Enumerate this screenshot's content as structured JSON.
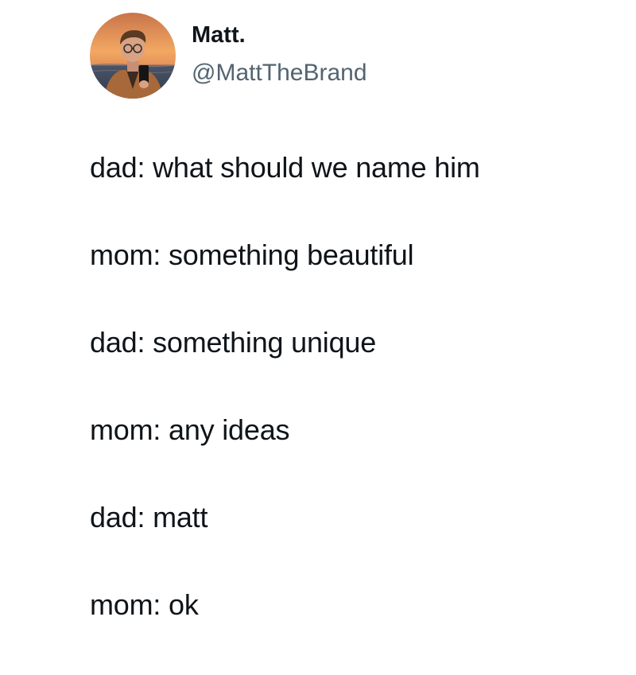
{
  "author": {
    "display_name": "Matt.",
    "handle": "@MattTheBrand"
  },
  "avatar": {
    "icon": "profile-photo-avatar",
    "colors": {
      "sky_top": "#e28a4a",
      "sky_mid": "#f4b26a",
      "sea": "#3a4a5e",
      "jacket": "#a8693a",
      "skin": "#d8a283",
      "hair": "#5a3a22"
    }
  },
  "tweet": {
    "lines": [
      "dad: what should we name him",
      "mom: something beautiful",
      "dad: something unique",
      "mom: any ideas",
      "dad: matt",
      "mom: ok"
    ]
  },
  "colors": {
    "text": "#0f1419",
    "secondary_text": "#536471",
    "background": "#ffffff"
  }
}
